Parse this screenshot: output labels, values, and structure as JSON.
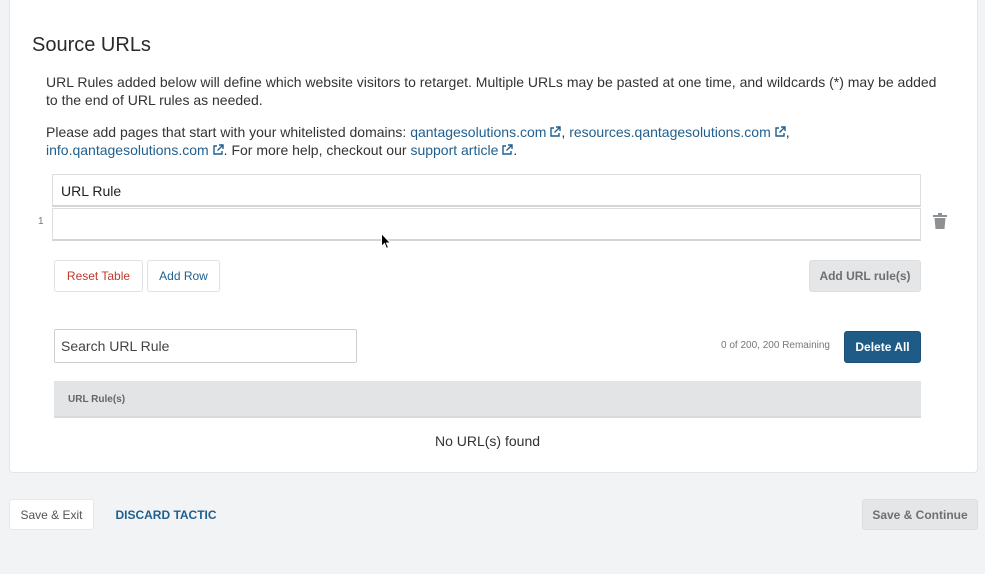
{
  "section": {
    "title": "Source URLs",
    "description": "URL Rules added below will define which website visitors to retarget. Multiple URLs may be pasted at one time, and wildcards (*) may be added to the end of URL rules as needed.",
    "domains_intro": "Please add pages that start with your whitelisted domains: ",
    "domains": [
      "qantagesolutions.com",
      "resources.qantagesolutions.com",
      "info.qantagesolutions.com"
    ],
    "help_text": " For more help, checkout our ",
    "help_link": "support article"
  },
  "editor": {
    "column_header": "URL Rule",
    "rows": [
      {
        "number": "1",
        "value": ""
      }
    ],
    "reset_label": "Reset Table",
    "add_row_label": "Add Row",
    "add_rule_label": "Add URL rule(s)"
  },
  "list": {
    "search_placeholder": "Search URL Rule",
    "remaining": "0 of 200, 200 Remaining",
    "delete_all_label": "Delete All",
    "column_header": "URL Rule(s)",
    "empty_text": "No URL(s) found"
  },
  "footer": {
    "save_exit": "Save & Exit",
    "discard": "DISCARD TACTIC",
    "save_continue": "Save & Continue"
  },
  "colors": {
    "link": "#1f5f8f",
    "primary": "#1e5b86",
    "danger": "#c0392b",
    "disabled": "#e5e6e8"
  },
  "icons": {
    "external": "external-link-icon",
    "delete": "trash-icon"
  }
}
